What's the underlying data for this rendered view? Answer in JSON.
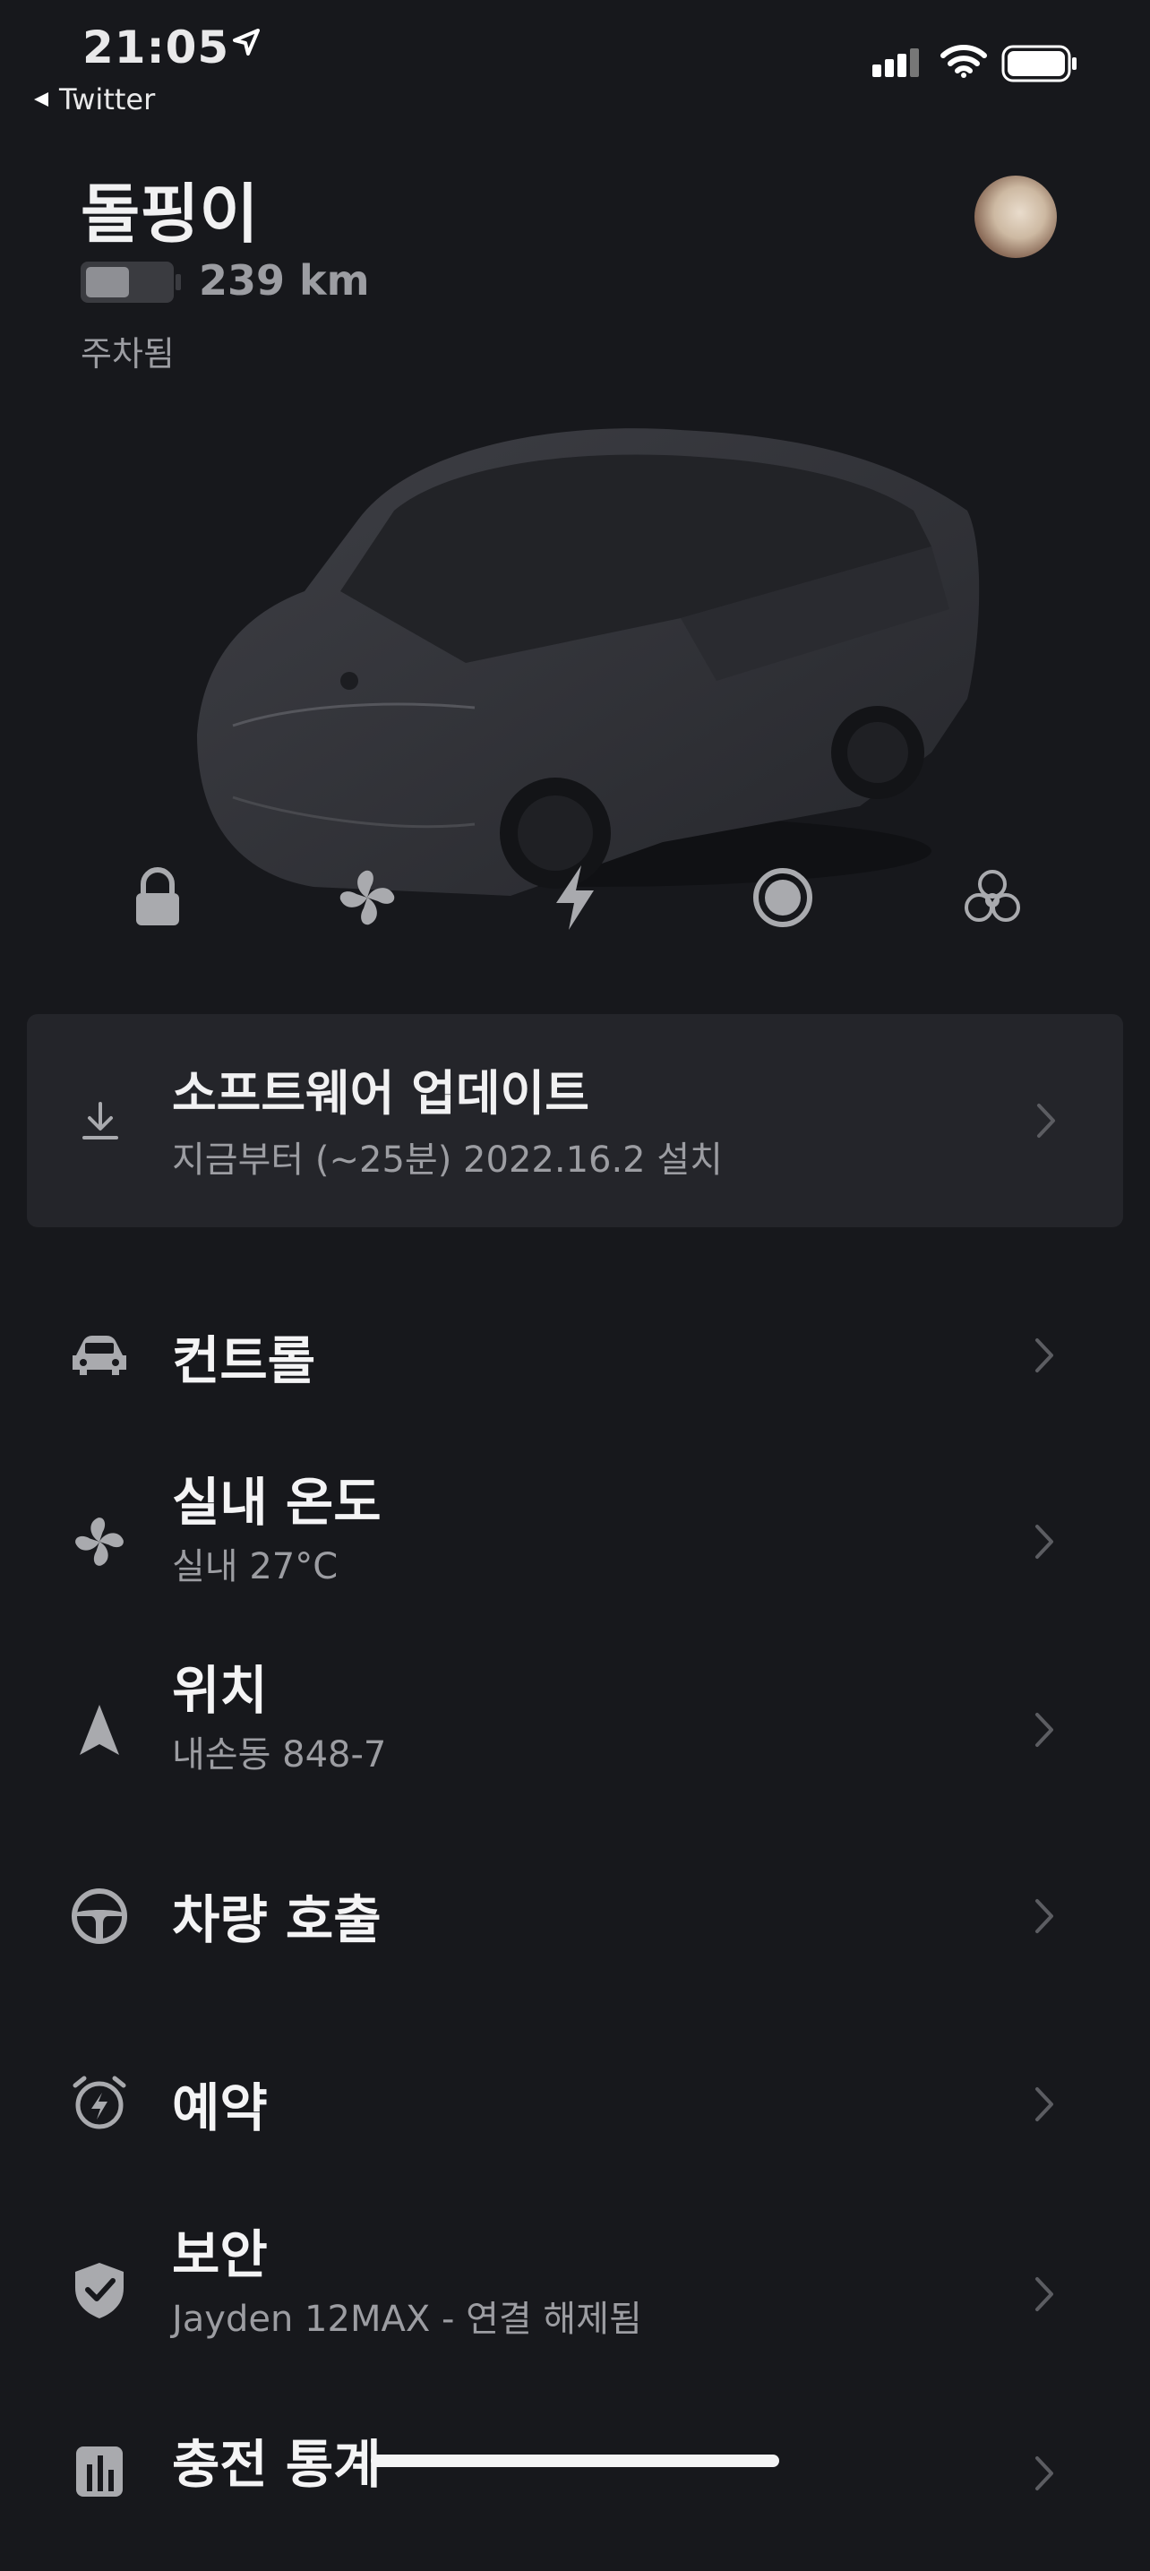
{
  "status_bar": {
    "time": "21:05",
    "back_app": "Twitter"
  },
  "vehicle": {
    "name": "돌핑이",
    "range": "239 km",
    "state": "주차됨",
    "battery_level": 0.45
  },
  "quick_actions": [
    {
      "icon": "lock-icon"
    },
    {
      "icon": "fan-icon"
    },
    {
      "icon": "charge-bolt-icon"
    },
    {
      "icon": "sentry-mode-icon"
    },
    {
      "icon": "bioweapon-defense-icon"
    }
  ],
  "software_update": {
    "title": "소프트웨어 업데이트",
    "subtitle": "지금부터 (~25분) 2022.16.2 설치"
  },
  "menu": [
    {
      "icon": "car-icon",
      "label": "컨트롤",
      "sub": ""
    },
    {
      "icon": "fan-icon",
      "label": "실내 온도",
      "sub": "실내 27°C"
    },
    {
      "icon": "location-arrow-icon",
      "label": "위치",
      "sub": "내손동 848-7"
    },
    {
      "icon": "steering-wheel-icon",
      "label": "차량 호출",
      "sub": ""
    },
    {
      "icon": "alarm-clock-icon",
      "label": "예약",
      "sub": ""
    },
    {
      "icon": "shield-check-icon",
      "label": "보안",
      "sub": "Jayden 12MAX - 연결 해제됨"
    },
    {
      "icon": "bar-chart-icon",
      "label": "충전 통계",
      "sub": ""
    }
  ],
  "colors": {
    "background": "#17181c",
    "card": "#24252a",
    "text": "#f4f4f5",
    "muted": "#9c9da2"
  }
}
